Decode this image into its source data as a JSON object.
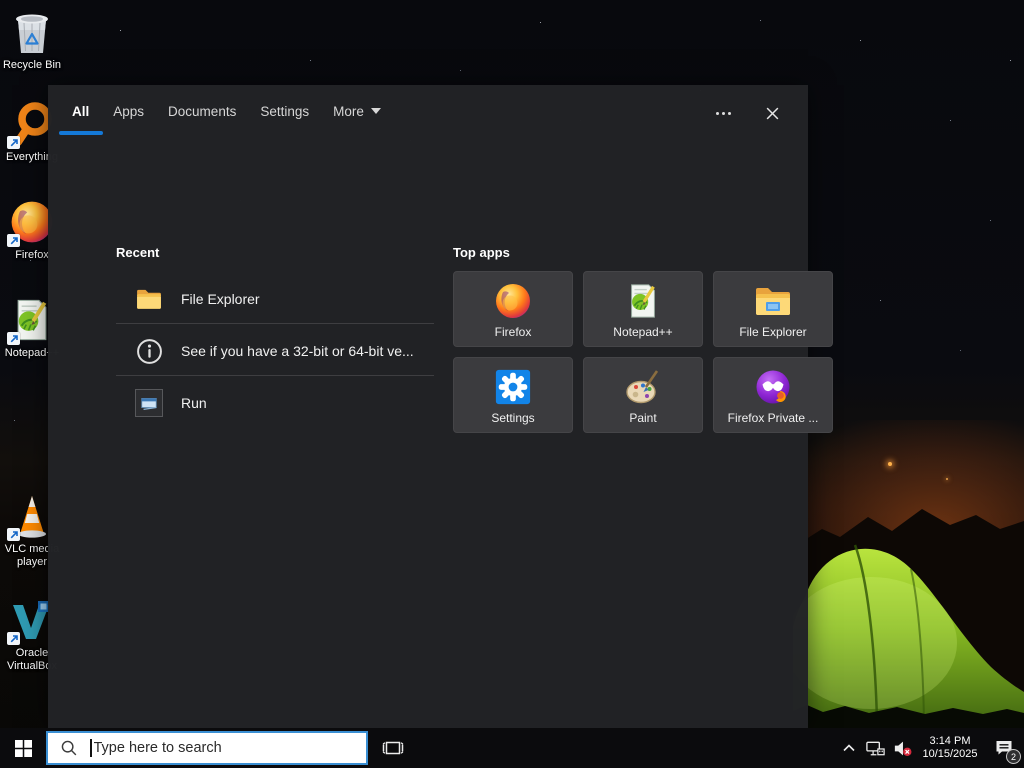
{
  "desktop": {
    "icons": [
      {
        "icon": "recycle-bin-icon",
        "label": "Recycle Bin"
      },
      {
        "icon": "everything-icon",
        "label": "Everything"
      },
      {
        "icon": "firefox-icon",
        "label": "Firefox"
      },
      {
        "icon": "notepad-plus-plus-icon",
        "label": "Notepad++"
      },
      {
        "icon": "vlc-icon",
        "label": "VLC media player"
      },
      {
        "icon": "virtualbox-icon",
        "label": "Oracle VirtualBox"
      }
    ]
  },
  "search_panel": {
    "tabs": [
      {
        "label": "All",
        "selected": true
      },
      {
        "label": "Apps",
        "selected": false
      },
      {
        "label": "Documents",
        "selected": false
      },
      {
        "label": "Settings",
        "selected": false
      },
      {
        "label": "More",
        "selected": false,
        "has_dropdown": true
      }
    ],
    "recent": {
      "header": "Recent",
      "items": [
        {
          "icon": "file-explorer-icon",
          "label": "File Explorer"
        },
        {
          "icon": "info-icon",
          "label": "See if you have a 32-bit or 64-bit ve..."
        },
        {
          "icon": "run-icon",
          "label": "Run"
        }
      ]
    },
    "top_apps": {
      "header": "Top apps",
      "items": [
        {
          "icon": "firefox-icon",
          "label": "Firefox"
        },
        {
          "icon": "notepad-plus-plus-icon",
          "label": "Notepad++"
        },
        {
          "icon": "file-explorer-icon",
          "label": "File Explorer"
        },
        {
          "icon": "settings-icon",
          "label": "Settings"
        },
        {
          "icon": "paint-icon",
          "label": "Paint"
        },
        {
          "icon": "firefox-private-icon",
          "label": "Firefox Private ..."
        }
      ]
    }
  },
  "taskbar": {
    "search": {
      "placeholder": "Type here to search"
    },
    "tray": {
      "time": "3:14 PM",
      "date": "10/15/2025",
      "notification_count": "2"
    }
  },
  "colors": {
    "accent": "#1479d8",
    "panel_bg": "#222326",
    "tile_bg": "#3b3b3e",
    "taskbar_bg": "#0b0b0d"
  }
}
